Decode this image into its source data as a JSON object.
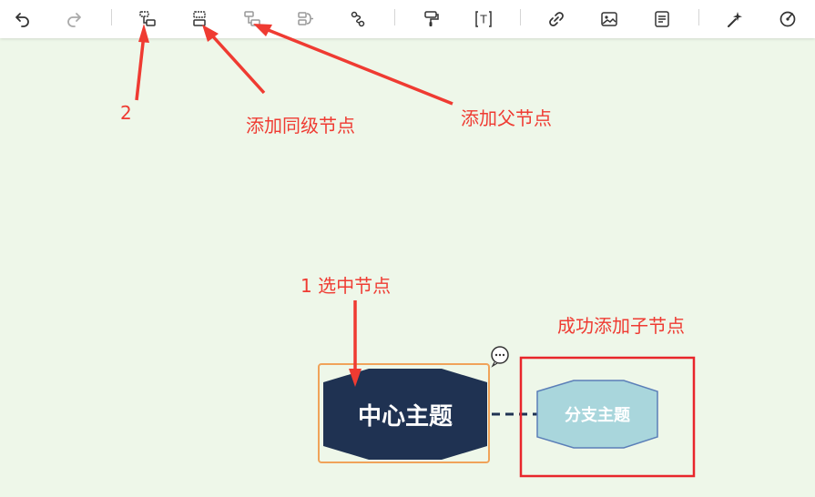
{
  "toolbar": {
    "items": [
      {
        "icon": "undo-icon"
      },
      {
        "icon": "redo-icon"
      },
      {
        "icon": "add-child-node-icon"
      },
      {
        "icon": "add-sibling-node-icon"
      },
      {
        "icon": "add-parent-node-icon"
      },
      {
        "icon": "add-summary-icon"
      },
      {
        "icon": "relation-line-icon"
      },
      {
        "icon": "format-painter-icon"
      },
      {
        "icon": "insert-text-icon",
        "glyph": "T"
      },
      {
        "icon": "link-icon"
      },
      {
        "icon": "image-icon"
      },
      {
        "icon": "note-icon"
      },
      {
        "icon": "magic-wand-icon"
      },
      {
        "icon": "target-icon"
      }
    ]
  },
  "mindmap": {
    "root": {
      "label": "中心主题",
      "fill": "#1f3252",
      "selected_border": "#f0a35a"
    },
    "child": {
      "label": "分支主题",
      "fill": "#a9d6dc",
      "border": "#5b7fb8"
    },
    "comment_icon": "comment-icon"
  },
  "annotations": {
    "step2": "2",
    "add_sibling": "添加同级节点",
    "add_parent": "添加父节点",
    "step1": "1 选中节点",
    "success": "成功添加子节点",
    "color": "#ef3b32"
  }
}
